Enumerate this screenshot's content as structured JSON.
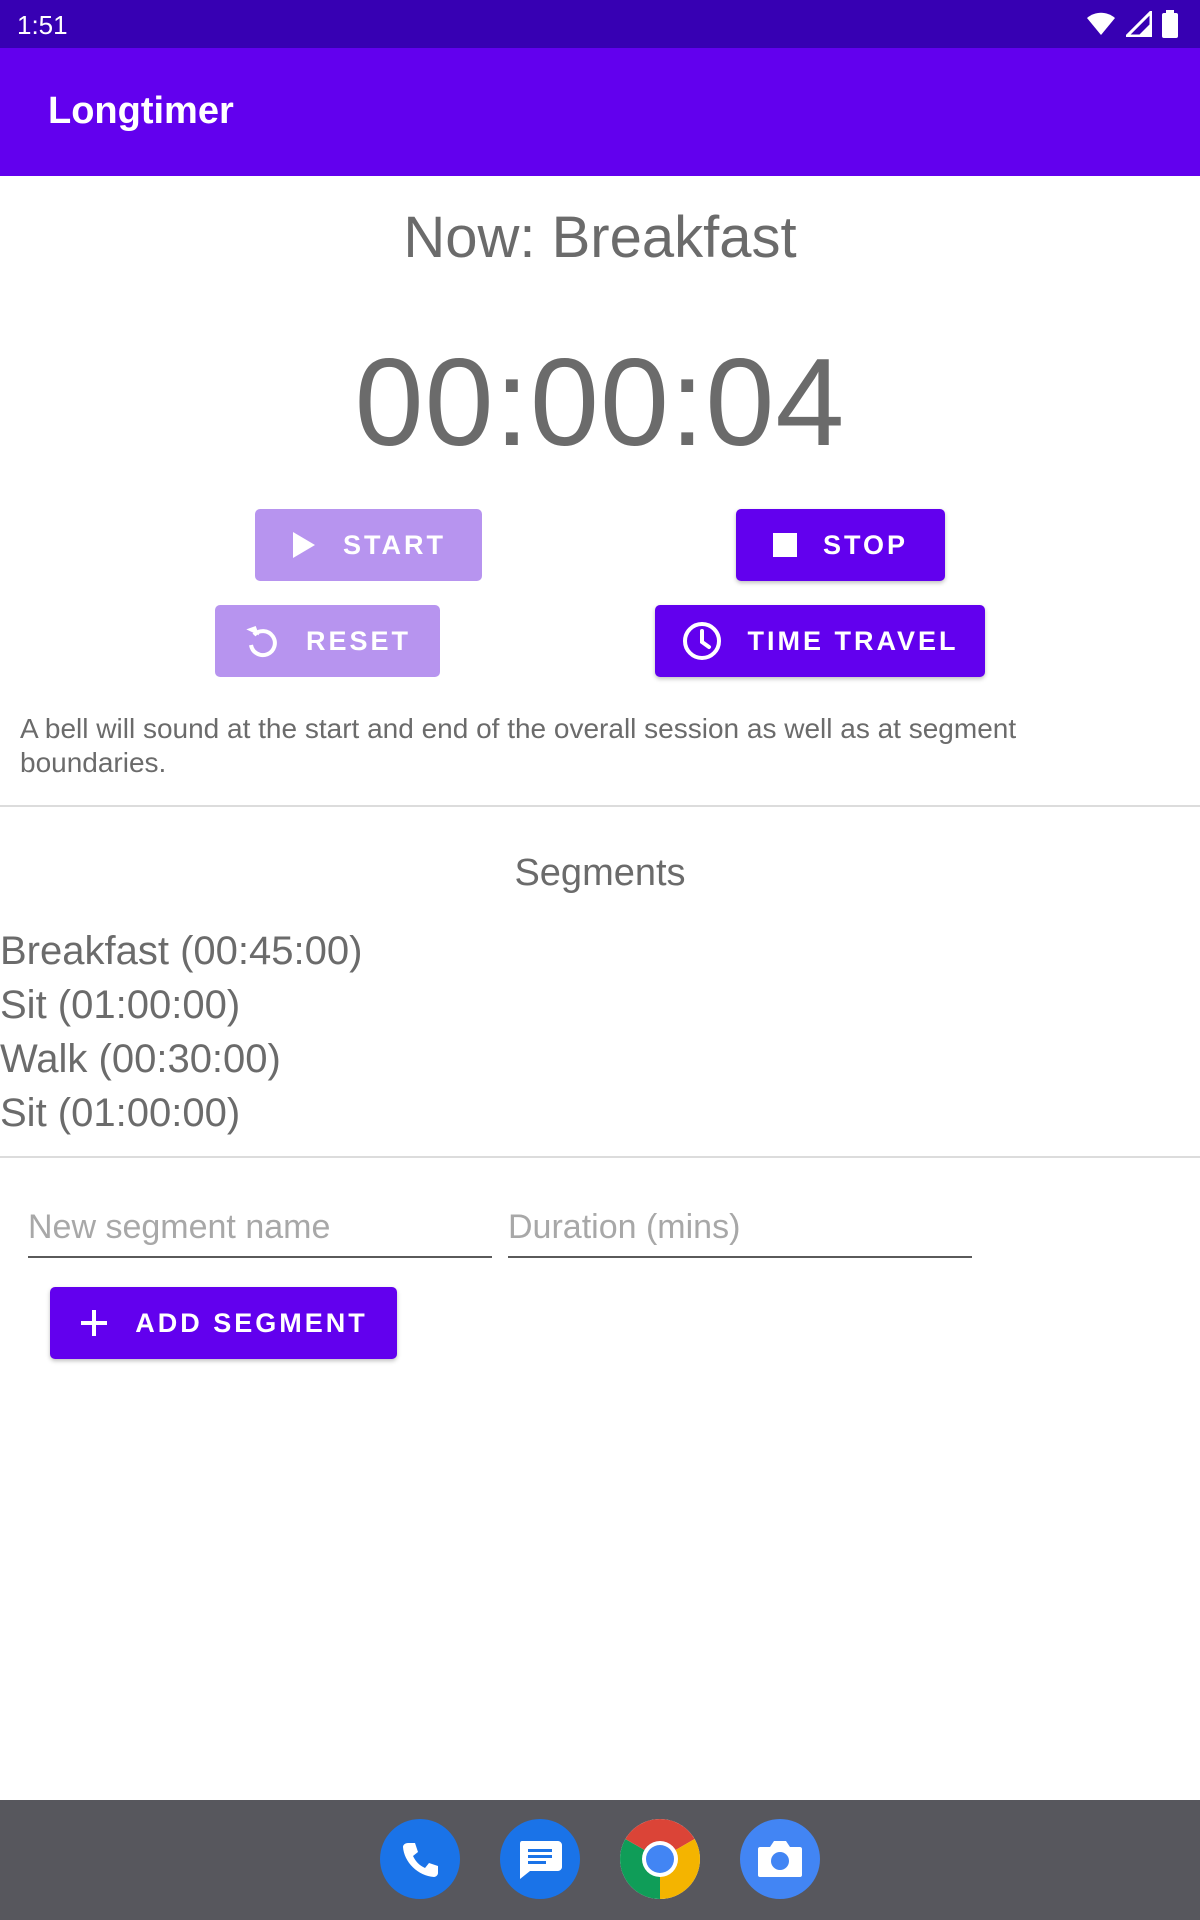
{
  "status_bar": {
    "time": "1:51",
    "icons": [
      "wifi-icon",
      "signal-icon",
      "battery-icon"
    ]
  },
  "app_bar": {
    "title": "Longtimer"
  },
  "current": {
    "label": "Now: Breakfast",
    "timer": "00:00:04"
  },
  "buttons": {
    "start": "START",
    "stop": "STOP",
    "reset": "RESET",
    "time_travel": "TIME TRAVEL",
    "add_segment": "ADD SEGMENT"
  },
  "info_text": "A bell will sound at the start and end of the overall session as well as at segment boundaries.",
  "segments": {
    "heading": "Segments",
    "items": [
      "Breakfast (00:45:00)",
      "Sit (01:00:00)",
      "Walk (00:30:00)",
      "Sit (01:00:00)"
    ]
  },
  "form": {
    "name_placeholder": "New segment name",
    "duration_placeholder": "Duration (mins)"
  },
  "dock": [
    "phone-icon",
    "messages-icon",
    "chrome-icon",
    "camera-icon"
  ],
  "colors": {
    "status_bar": "#3700b3",
    "primary": "#6200ee",
    "primary_disabled": "#b794ef",
    "text": "#6b6b6b",
    "nav_bar": "#57575d"
  }
}
